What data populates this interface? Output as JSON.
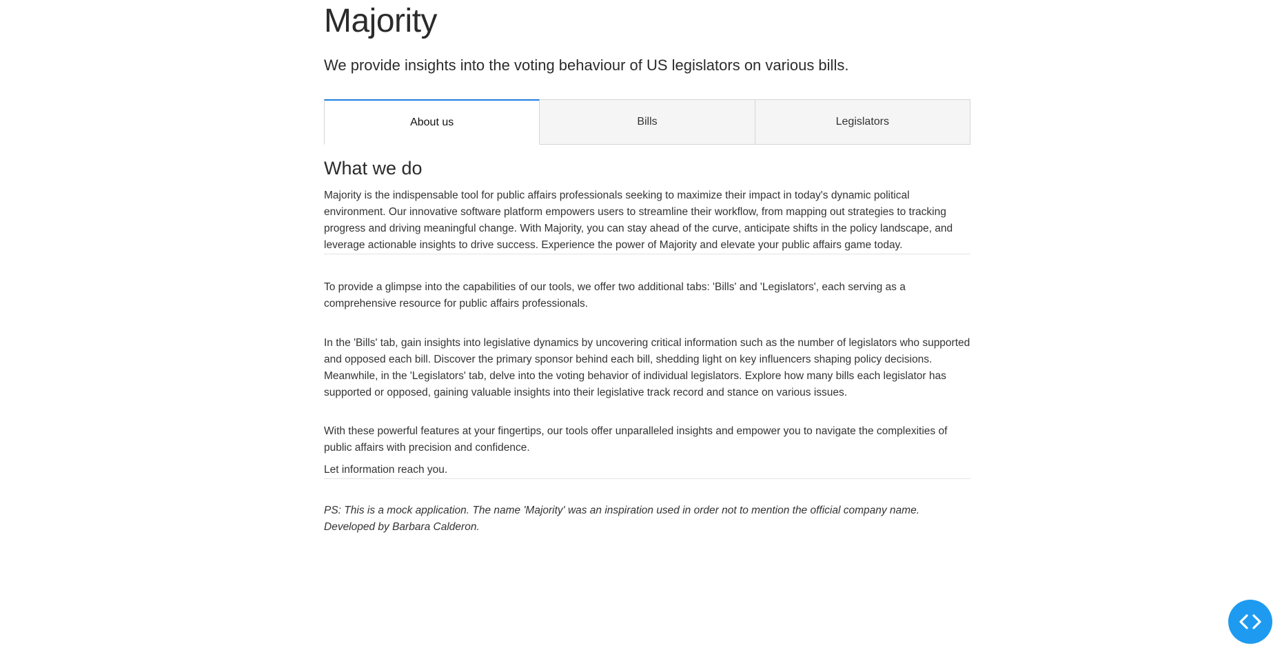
{
  "header": {
    "title": "Majority",
    "subtitle": "We provide insights into the voting behaviour of US legislators on various bills."
  },
  "tabs": [
    {
      "label": "About us",
      "active": true
    },
    {
      "label": "Bills",
      "active": false
    },
    {
      "label": "Legislators",
      "active": false
    }
  ],
  "about": {
    "heading": "What we do",
    "intro": "Majority is the indispensable tool for public affairs professionals seeking to maximize their impact in today's dynamic political environment. Our innovative software platform empowers users to streamline their workflow, from mapping out strategies to tracking progress and driving meaningful change. With Majority, you can stay ahead of the curve, anticipate shifts in the policy landscape, and leverage actionable insights to drive success. Experience the power of Majority and elevate your public affairs game today.",
    "glimpse": "To provide a glimpse into the capabilities of our tools, we offer two additional tabs: 'Bills' and 'Legislators', each serving as a comprehensive resource for public affairs professionals.",
    "tabs_detail": "In the 'Bills' tab, gain insights into legislative dynamics by uncovering critical information such as the number of legislators who supported and opposed each bill. Discover the primary sponsor behind each bill, shedding light on key influencers shaping policy decisions. Meanwhile, in the 'Legislators' tab, delve into the voting behavior of individual legislators. Explore how many bills each legislator has supported or opposed, gaining valuable insights into their legislative track record and stance on various issues.",
    "features": "With these powerful features at your fingertips, our tools offer unparalleled insights and empower you to navigate the complexities of public affairs with precision and confidence.",
    "tagline": "Let information reach you.",
    "ps": "PS: This is a mock application. The name 'Majority' was an inspiration used in order not to mention the official company name. Developed by Barbara Calderon."
  },
  "fab": {
    "icon": "code-icon",
    "color": "#1e9bf0"
  },
  "colors": {
    "accent": "#1e7ee0",
    "text": "#333333",
    "tab_background": "#f5f5f5"
  }
}
